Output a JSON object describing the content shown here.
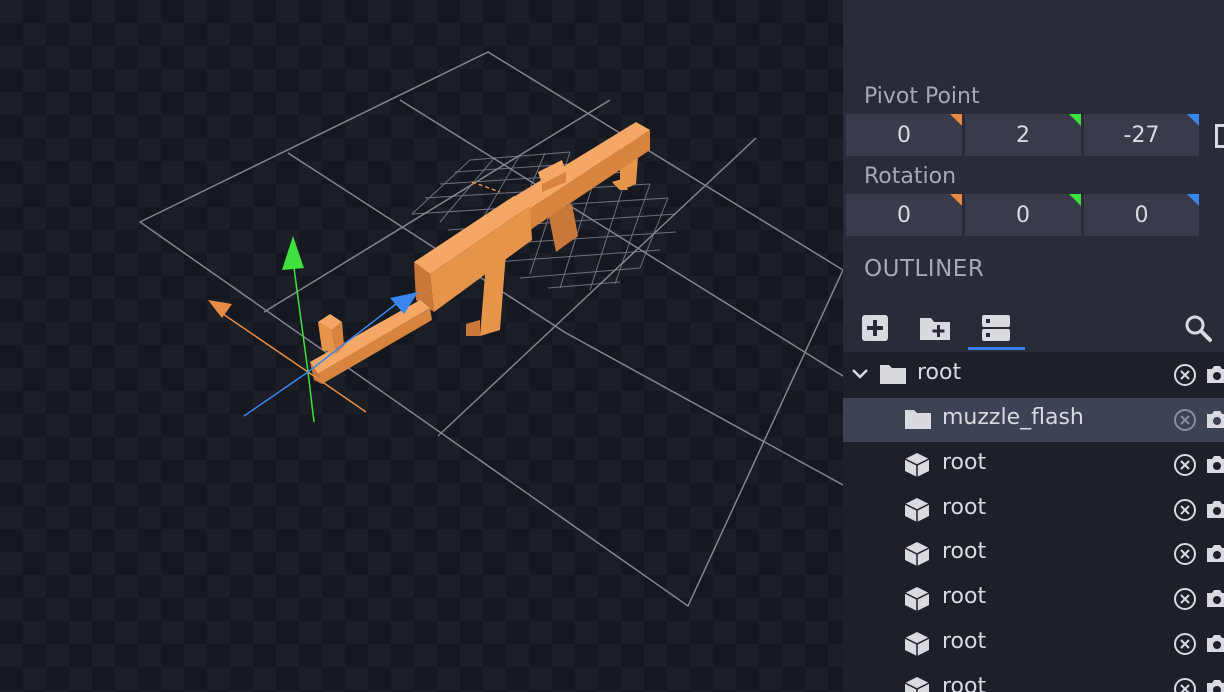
{
  "inspector": {
    "pivot_label": "Pivot Point",
    "pivot": {
      "x": "0",
      "y": "2",
      "z": "-27"
    },
    "rotation_label": "Rotation",
    "rotation": {
      "x": "0",
      "y": "0",
      "z": "0"
    }
  },
  "outliner": {
    "title": "OUTLINER",
    "toolbar": {
      "add_cube": "plus-icon",
      "add_group": "folder-plus-icon",
      "sort": "outliner-toggle-icon",
      "search": "search-icon"
    },
    "items": [
      {
        "label": "root",
        "type": "group",
        "expanded": true
      },
      {
        "label": "muzzle_flash",
        "type": "group",
        "selected": true
      },
      {
        "label": "root",
        "type": "cube"
      },
      {
        "label": "root",
        "type": "cube"
      },
      {
        "label": "root",
        "type": "cube"
      },
      {
        "label": "root",
        "type": "cube"
      },
      {
        "label": "root",
        "type": "cube"
      },
      {
        "label": "root",
        "type": "cube"
      }
    ]
  },
  "colors": {
    "model": "#e7944b",
    "axis_x": "#e98b47",
    "axis_y": "#3de03d",
    "axis_z": "#3b85f0",
    "accent": "#3b85f0",
    "panel": "#292b37",
    "selected_row": "#3d4255"
  }
}
